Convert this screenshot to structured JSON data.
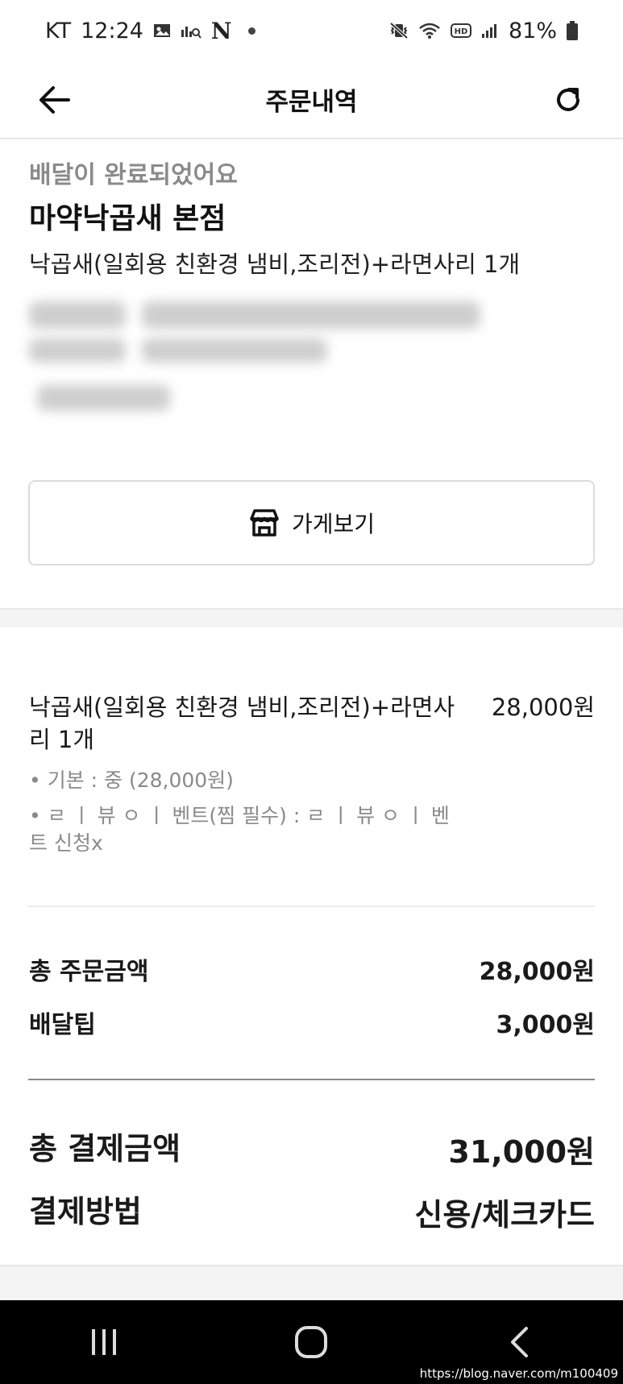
{
  "status_bar": {
    "carrier": "KT",
    "time": "12:24",
    "app_badge": "N",
    "battery": "81%"
  },
  "header": {
    "title": "주문내역"
  },
  "order": {
    "status": "배달이 완료되었어요",
    "store_name": "마약낙곱새 본점",
    "summary": "낙곱새(일회용 친환경 냄비,조리전)+라면사리 1개",
    "store_button_label": "가게보기"
  },
  "item": {
    "name": "낙곱새(일회용 친환경 냄비,조리전)+라면사리 1개",
    "price": "28,000원",
    "options": [
      "• 기본 : 중 (28,000원)",
      "• ㄹ ㅣ 뷰 ㅇ ㅣ 벤트(찜 필수) : ㄹ ㅣ 뷰 ㅇ ㅣ 벤트 신청x"
    ]
  },
  "totals": {
    "order_amount_label": "총 주문금액",
    "order_amount": "28,000원",
    "delivery_tip_label": "배달팁",
    "delivery_tip": "3,000원",
    "payment_total_label": "총 결제금액",
    "payment_total": "31,000원",
    "payment_method_label": "결제방법",
    "payment_method": "신용/체크카드"
  },
  "watermark": "https://blog.naver.com/m100409",
  "icons": {
    "back": "arrow-left-icon",
    "refresh": "refresh-icon",
    "store": "store-icon",
    "nav_recent": "recent-apps-icon",
    "nav_home": "home-icon",
    "nav_back": "back-chevron-icon"
  },
  "colors": {
    "muted_text": "#8a8a8a",
    "section_bg": "#f4f4f4",
    "nav_bar": "#000000"
  }
}
